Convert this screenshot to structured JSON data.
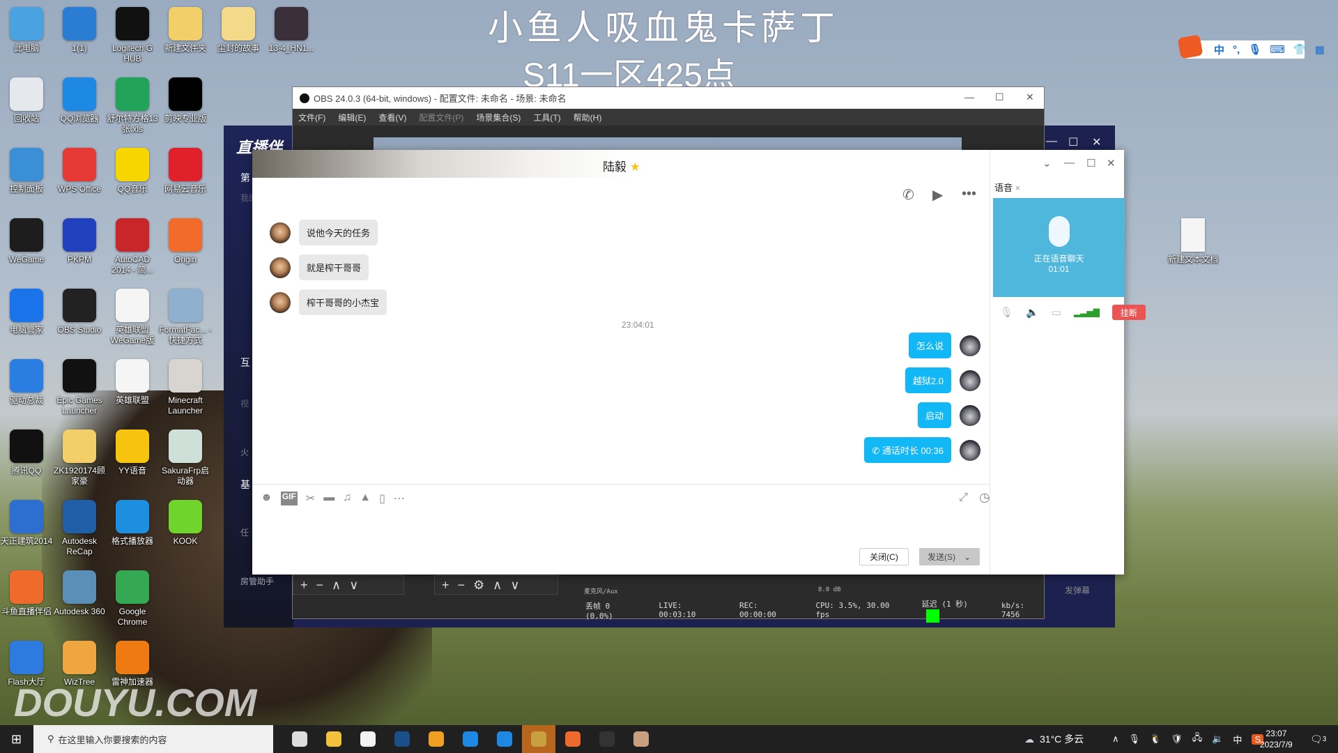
{
  "overlay": {
    "line1": "小鱼人吸血鬼卡萨丁",
    "line2": "S11一区425点"
  },
  "desktop_icons": [
    {
      "label": "此电脑",
      "color": "#4aa3e0",
      "col": 0,
      "row": 0
    },
    {
      "label": "1(1)",
      "color": "#2b7cd3",
      "col": 1,
      "row": 0
    },
    {
      "label": "Logitech G HUB",
      "color": "#111111",
      "col": 2,
      "row": 0
    },
    {
      "label": "新建文件夹",
      "color": "#f3cf6a",
      "col": 3,
      "row": 0
    },
    {
      "label": "尘封的故事",
      "color": "#f3d98a",
      "col": 4,
      "row": 0
    },
    {
      "label": "13-4_HN1...",
      "color": "#3a2f3a",
      "col": 5,
      "row": 0
    },
    {
      "label": "回收站",
      "color": "#e5e8ec",
      "col": 0,
      "row": 1
    },
    {
      "label": "QQ浏览器",
      "color": "#1e88e5",
      "col": 1,
      "row": 1
    },
    {
      "label": "舒尔特方格13张.xls",
      "color": "#21a35a",
      "col": 2,
      "row": 1
    },
    {
      "label": "剪映专业版",
      "color": "#000000",
      "col": 3,
      "row": 1
    },
    {
      "label": "控制面板",
      "color": "#3a8fd6",
      "col": 0,
      "row": 2
    },
    {
      "label": "WPS Office",
      "color": "#e53935",
      "col": 1,
      "row": 2
    },
    {
      "label": "QQ音乐",
      "color": "#f7d600",
      "col": 2,
      "row": 2
    },
    {
      "label": "网易云音乐",
      "color": "#e0202b",
      "col": 3,
      "row": 2
    },
    {
      "label": "WeGame",
      "color": "#1d1d1d",
      "col": 0,
      "row": 3
    },
    {
      "label": "PKPM",
      "color": "#2040c0",
      "col": 1,
      "row": 3
    },
    {
      "label": "AutoCAD 2014 - 简...",
      "color": "#c9262a",
      "col": 2,
      "row": 3
    },
    {
      "label": "Origin",
      "color": "#f26b2a",
      "col": 3,
      "row": 3
    },
    {
      "label": "电脑管家",
      "color": "#1a73e8",
      "col": 0,
      "row": 4
    },
    {
      "label": "OBS Studio",
      "color": "#222222",
      "col": 1,
      "row": 4
    },
    {
      "label": "英雄联盟WeGame版",
      "color": "#f5f5f5",
      "col": 2,
      "row": 4
    },
    {
      "label": "FormatFac... - 快捷方式",
      "color": "#8fb0cf",
      "col": 3,
      "row": 4
    },
    {
      "label": "驱动总裁",
      "color": "#2a7de1",
      "col": 0,
      "row": 5
    },
    {
      "label": "Epic Games Launcher",
      "color": "#111111",
      "col": 1,
      "row": 5
    },
    {
      "label": "英雄联盟",
      "color": "#f5f5f5",
      "col": 2,
      "row": 5
    },
    {
      "label": "Minecraft Launcher",
      "color": "#d8d4d0",
      "col": 3,
      "row": 5
    },
    {
      "label": "腾讯QQ",
      "color": "#111111",
      "col": 0,
      "row": 6
    },
    {
      "label": "ZK1920174顾家豪",
      "color": "#f3cf6a",
      "col": 1,
      "row": 6
    },
    {
      "label": "YY语音",
      "color": "#f6c40f",
      "col": 2,
      "row": 6
    },
    {
      "label": "SakuraFrp启动器",
      "color": "#cfe0d8",
      "col": 3,
      "row": 6
    },
    {
      "label": "天正建筑2014",
      "color": "#2c6fd1",
      "col": 0,
      "row": 7
    },
    {
      "label": "Autodesk ReCap",
      "color": "#1e5fa8",
      "col": 1,
      "row": 7
    },
    {
      "label": "格式播放器",
      "color": "#1c8fe0",
      "col": 2,
      "row": 7
    },
    {
      "label": "KOOK",
      "color": "#6fd42c",
      "col": 3,
      "row": 7
    },
    {
      "label": "斗鱼直播伴侣",
      "color": "#f06a2c",
      "col": 0,
      "row": 8
    },
    {
      "label": "Autodesk 360",
      "color": "#5c8fb8",
      "col": 1,
      "row": 8
    },
    {
      "label": "Google Chrome",
      "color": "#34a853",
      "col": 2,
      "row": 8
    },
    {
      "label": "Flash大厅",
      "color": "#2d7be0",
      "col": 0,
      "row": 9
    },
    {
      "label": "WizTree",
      "color": "#f0a640",
      "col": 1,
      "row": 9
    },
    {
      "label": "雷神加速器",
      "color": "#f07a12",
      "col": 2,
      "row": 9
    }
  ],
  "desktop_right_icon": {
    "label": "新建文本文档"
  },
  "ime_bar": {
    "mode": "中",
    "punct": "°,",
    "icons": [
      "mic-icon",
      "keyboard-icon",
      "skin-icon",
      "toolbox-icon"
    ]
  },
  "douyu": {
    "logo": "直播伴",
    "sections": [
      "第",
      "我的",
      "互",
      "视",
      "火",
      "基",
      "任",
      "房管助手"
    ],
    "danmu": "发弹幕"
  },
  "obs": {
    "title": "OBS 24.0.3 (64-bit, windows) - 配置文件: 未命名 - 场景: 未命名",
    "menu": [
      "文件(F)",
      "编辑(E)",
      "查看(V)",
      "配置文件(P)",
      "场景集合(S)",
      "工具(T)",
      "帮助(H)"
    ],
    "menu_disabled": [
      3
    ],
    "mixer_source": "麦克风/Aux",
    "mixer_db": "8.0 dB",
    "status": {
      "dropped": "丢帧 0 (0.0%)",
      "live": "LIVE: 00:03:10",
      "rec": "REC: 00:00:00",
      "cpu": "CPU: 3.5%, 30.00 fps",
      "delay": "延迟 (1 秒)",
      "kbps": "kb/s: 7456",
      "health_color": "#00ff00"
    }
  },
  "qq": {
    "contact": "陆毅",
    "badge": "★",
    "messages_left": [
      "说他今天的任务",
      "就是榨干哥哥",
      "榨干哥哥的小杰宝"
    ],
    "timestamp": "23:04:01",
    "messages_right": [
      "怎么说",
      "越狱2.0",
      "启动",
      "通话时长 00:36"
    ],
    "close_button": "关闭(C)",
    "send_button": "发送(S)",
    "voice_tab": "语音",
    "voice_status": "正在语音聊天",
    "voice_time": "01:01",
    "hangup": "挂断",
    "bubble_color": "#12b7f5"
  },
  "taskbar": {
    "search_placeholder": "在这里输入你要搜索的内容",
    "apps": [
      {
        "name": "task-view",
        "color": "#dddddd"
      },
      {
        "name": "file-explorer",
        "color": "#f3c13a"
      },
      {
        "name": "microsoft-store",
        "color": "#f3f3f3"
      },
      {
        "name": "steam",
        "color": "#1b4f8a"
      },
      {
        "name": "logitech-g-hub",
        "color": "#f0a020"
      },
      {
        "name": "qq-browser",
        "color": "#1e88e5"
      },
      {
        "name": "qq-browser-2",
        "color": "#1e88e5"
      },
      {
        "name": "league-of-legends",
        "color": "#c8a040",
        "active": true
      },
      {
        "name": "douyu-companion",
        "color": "#f06a2c"
      },
      {
        "name": "obs-studio",
        "color": "#333333"
      },
      {
        "name": "photo-app",
        "color": "#c8a080"
      }
    ],
    "weather": "31°C 多云",
    "ime": "中",
    "time": "23:07",
    "date": "2023/7/9",
    "notifications": "3"
  },
  "watermark": "DOUYU.COM"
}
